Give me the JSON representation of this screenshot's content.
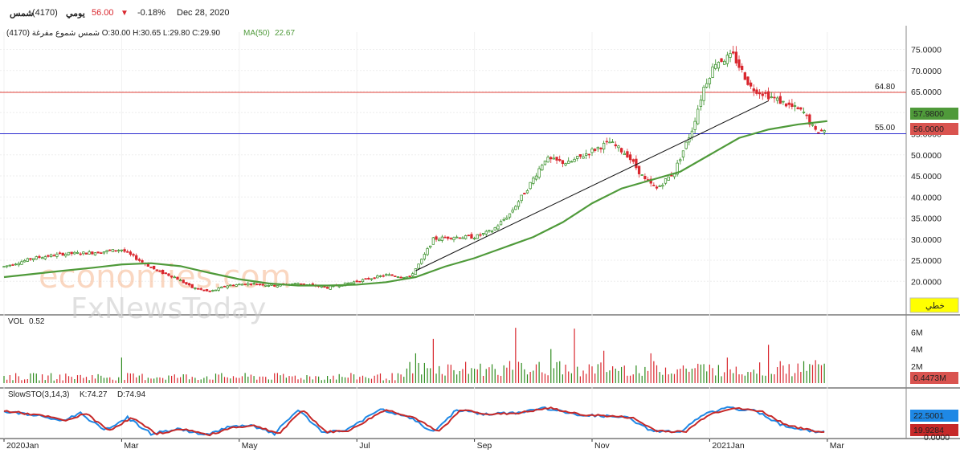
{
  "header": {
    "symbol": "شمس",
    "code": "(4170)",
    "period": "يومي",
    "last_price": "56.00",
    "change_pct": "-0.18%",
    "date": "Dec 28, 2020"
  },
  "info_line": {
    "ohlc": "شمس شموع مفرغة (4170) O:30.00 H:30.65 L:29.80 C:29.90",
    "ma_label": "MA(50)",
    "ma_value": "22.67"
  },
  "watermark": {
    "line1": "economies.com",
    "line2": "FxNewsToday"
  },
  "colors": {
    "up": "#2e8b1e",
    "down": "#d9272e",
    "ma": "#4f9a3a",
    "resistance": "#e0403a",
    "support": "#2b2bcf",
    "trend": "#111111",
    "stoch_k": "#1e88e5",
    "stoch_d": "#c62828"
  },
  "price_panel": {
    "resistance_label": "64.80",
    "support_label": "55.00",
    "ma_price_tag": "57.9800",
    "last_price_tag": "56.0000",
    "style_button": "خطي"
  },
  "volume_panel": {
    "label": "VOL",
    "value": "0.52",
    "last_tag": "0.4473M"
  },
  "stoch_panel": {
    "label": "SlowSTO(3,14,3)",
    "k_label": "K:74.27",
    "d_label": "D:74.94",
    "k_tag": "22.5001",
    "d_tag": "19.9284"
  },
  "chart_data": {
    "type": "candlestick",
    "price_axis": {
      "ticks": [
        "75.0000",
        "70.0000",
        "65.0000",
        "60.0000",
        "55.0000",
        "50.0000",
        "45.0000",
        "40.0000",
        "35.0000",
        "30.0000",
        "25.0000",
        "20.0000"
      ],
      "ylim": [
        16,
        78
      ]
    },
    "volume_axis": {
      "ticks": [
        "6M",
        "4M",
        "2M"
      ]
    },
    "stoch_axis": {
      "ticks": [
        "0.0000"
      ]
    },
    "x_ticks": [
      "2020Jan",
      "Mar",
      "May",
      "Jul",
      "Sep",
      "Nov",
      "2021Jan",
      "Mar"
    ],
    "horizontal_lines": [
      64.8,
      55.0
    ],
    "trendline": [
      {
        "month": 7.0,
        "price": 22.5
      },
      {
        "month": 13.0,
        "price": 62.8
      }
    ],
    "price_path": [
      {
        "m": 0.0,
        "p": 23.5
      },
      {
        "m": 0.5,
        "p": 25.5
      },
      {
        "m": 1.0,
        "p": 26.5
      },
      {
        "m": 1.5,
        "p": 26.8
      },
      {
        "m": 2.0,
        "p": 27.5
      },
      {
        "m": 2.3,
        "p": 25.0
      },
      {
        "m": 2.6,
        "p": 22.5
      },
      {
        "m": 2.9,
        "p": 21.0
      },
      {
        "m": 3.2,
        "p": 18.5
      },
      {
        "m": 3.5,
        "p": 17.5
      },
      {
        "m": 3.8,
        "p": 19.0
      },
      {
        "m": 4.2,
        "p": 19.5
      },
      {
        "m": 4.6,
        "p": 19.0
      },
      {
        "m": 5.0,
        "p": 19.5
      },
      {
        "m": 5.5,
        "p": 18.5
      },
      {
        "m": 6.0,
        "p": 20.0
      },
      {
        "m": 6.5,
        "p": 21.5
      },
      {
        "m": 6.9,
        "p": 21.0
      },
      {
        "m": 7.1,
        "p": 25.0
      },
      {
        "m": 7.3,
        "p": 30.0
      },
      {
        "m": 7.6,
        "p": 30.5
      },
      {
        "m": 8.0,
        "p": 30.5
      },
      {
        "m": 8.3,
        "p": 32.0
      },
      {
        "m": 8.6,
        "p": 36.0
      },
      {
        "m": 8.9,
        "p": 42.0
      },
      {
        "m": 9.2,
        "p": 49.0
      },
      {
        "m": 9.6,
        "p": 48.0
      },
      {
        "m": 10.0,
        "p": 51.0
      },
      {
        "m": 10.3,
        "p": 53.0
      },
      {
        "m": 10.6,
        "p": 50.0
      },
      {
        "m": 10.9,
        "p": 44.0
      },
      {
        "m": 11.1,
        "p": 42.0
      },
      {
        "m": 11.4,
        "p": 46.0
      },
      {
        "m": 11.7,
        "p": 56.0
      },
      {
        "m": 11.9,
        "p": 66.0
      },
      {
        "m": 12.1,
        "p": 72.0
      },
      {
        "m": 12.4,
        "p": 73.5
      },
      {
        "m": 12.7,
        "p": 66.0
      },
      {
        "m": 13.0,
        "p": 64.0
      },
      {
        "m": 13.3,
        "p": 62.0
      },
      {
        "m": 13.6,
        "p": 60.0
      },
      {
        "m": 13.8,
        "p": 55.5
      },
      {
        "m": 14.0,
        "p": 56.0
      }
    ],
    "ma50_path": [
      {
        "m": 0.0,
        "p": 21.0
      },
      {
        "m": 1.0,
        "p": 22.5
      },
      {
        "m": 1.5,
        "p": 23.2
      },
      {
        "m": 2.0,
        "p": 24.0
      },
      {
        "m": 2.5,
        "p": 24.3
      },
      {
        "m": 3.0,
        "p": 23.6
      },
      {
        "m": 3.5,
        "p": 22.0
      },
      {
        "m": 4.0,
        "p": 20.5
      },
      {
        "m": 4.5,
        "p": 19.5
      },
      {
        "m": 5.0,
        "p": 19.0
      },
      {
        "m": 5.5,
        "p": 19.0
      },
      {
        "m": 6.0,
        "p": 19.2
      },
      {
        "m": 6.5,
        "p": 19.8
      },
      {
        "m": 7.0,
        "p": 21.0
      },
      {
        "m": 7.5,
        "p": 23.5
      },
      {
        "m": 8.0,
        "p": 25.5
      },
      {
        "m": 8.5,
        "p": 28.0
      },
      {
        "m": 9.0,
        "p": 30.5
      },
      {
        "m": 9.5,
        "p": 34.0
      },
      {
        "m": 10.0,
        "p": 38.5
      },
      {
        "m": 10.5,
        "p": 42.0
      },
      {
        "m": 11.0,
        "p": 44.0
      },
      {
        "m": 11.5,
        "p": 46.0
      },
      {
        "m": 12.0,
        "p": 50.0
      },
      {
        "m": 12.5,
        "p": 54.0
      },
      {
        "m": 13.0,
        "p": 56.0
      },
      {
        "m": 13.5,
        "p": 57.2
      },
      {
        "m": 14.0,
        "p": 58.0
      }
    ],
    "volume_peaks_m": [
      {
        "m": 2.0,
        "v": 3.0
      },
      {
        "m": 7.0,
        "v": 3.5
      },
      {
        "m": 7.3,
        "v": 5.2
      },
      {
        "m": 8.7,
        "v": 6.5
      },
      {
        "m": 9.3,
        "v": 4.0
      },
      {
        "m": 9.7,
        "v": 6.4
      },
      {
        "m": 10.2,
        "v": 3.8
      },
      {
        "m": 11.0,
        "v": 3.5
      },
      {
        "m": 12.3,
        "v": 3.0
      },
      {
        "m": 13.0,
        "v": 4.5
      },
      {
        "m": 13.8,
        "v": 2.7
      },
      {
        "m": 14.0,
        "v": 0.45
      }
    ],
    "stoch_k_keypoints": [
      {
        "m": 0.0,
        "v": 80
      },
      {
        "m": 0.6,
        "v": 65
      },
      {
        "m": 1.0,
        "v": 50
      },
      {
        "m": 1.3,
        "v": 75
      },
      {
        "m": 1.7,
        "v": 20
      },
      {
        "m": 2.1,
        "v": 60
      },
      {
        "m": 2.5,
        "v": 10
      },
      {
        "m": 3.0,
        "v": 25
      },
      {
        "m": 3.4,
        "v": 5
      },
      {
        "m": 3.8,
        "v": 30
      },
      {
        "m": 4.2,
        "v": 35
      },
      {
        "m": 4.6,
        "v": 10
      },
      {
        "m": 5.0,
        "v": 85
      },
      {
        "m": 5.4,
        "v": 15
      },
      {
        "m": 5.8,
        "v": 20
      },
      {
        "m": 6.4,
        "v": 85
      },
      {
        "m": 6.9,
        "v": 60
      },
      {
        "m": 7.3,
        "v": 15
      },
      {
        "m": 7.7,
        "v": 85
      },
      {
        "m": 8.2,
        "v": 70
      },
      {
        "m": 8.7,
        "v": 75
      },
      {
        "m": 9.2,
        "v": 90
      },
      {
        "m": 9.7,
        "v": 70
      },
      {
        "m": 10.2,
        "v": 65
      },
      {
        "m": 10.6,
        "v": 60
      },
      {
        "m": 11.0,
        "v": 20
      },
      {
        "m": 11.5,
        "v": 15
      },
      {
        "m": 11.9,
        "v": 70
      },
      {
        "m": 12.3,
        "v": 90
      },
      {
        "m": 12.8,
        "v": 80
      },
      {
        "m": 13.2,
        "v": 40
      },
      {
        "m": 13.5,
        "v": 25
      },
      {
        "m": 13.8,
        "v": 15
      },
      {
        "m": 14.0,
        "v": 22
      }
    ]
  }
}
